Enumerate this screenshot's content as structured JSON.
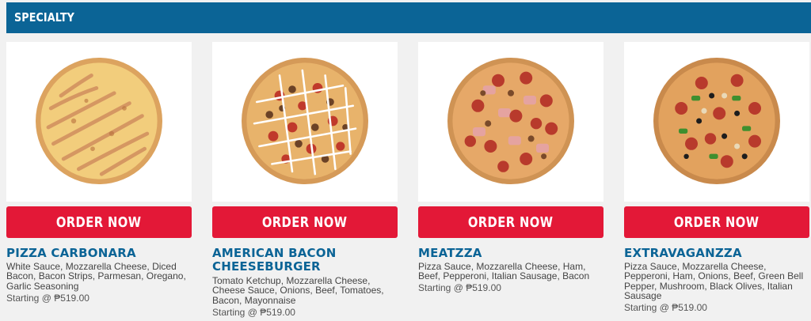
{
  "section": {
    "title": "SPECIALTY"
  },
  "colors": {
    "header": "#0b6496",
    "button": "#e31837",
    "name": "#0b6496"
  },
  "products": [
    {
      "name": "PIZZA CARBONARA",
      "description": "White Sauce, Mozzarella Cheese, Diced Bacon, Bacon Strips, Parmesan, Oregano, Garlic Seasoning",
      "price": "Starting @ ₱519.00",
      "button": "ORDER NOW"
    },
    {
      "name": "AMERICAN BACON CHEESEBURGER",
      "description": "Tomato Ketchup, Mozzarella Cheese, Cheese Sauce, Onions, Beef, Tomatoes, Bacon, Mayonnaise",
      "price": "Starting @ ₱519.00",
      "button": "ORDER NOW"
    },
    {
      "name": "MEATZZA",
      "description": "Pizza Sauce, Mozzarella Cheese, Ham, Beef, Pepperoni, Italian Sausage, Bacon",
      "price": "Starting @ ₱519.00",
      "button": "ORDER NOW"
    },
    {
      "name": "EXTRAVAGANZZA",
      "description": "Pizza Sauce, Mozzarella Cheese, Pepperoni, Ham, Onions, Beef, Green Bell Pepper, Mushroom, Black Olives, Italian Sausage",
      "price": "Starting @ ₱519.00",
      "button": "ORDER NOW"
    }
  ]
}
